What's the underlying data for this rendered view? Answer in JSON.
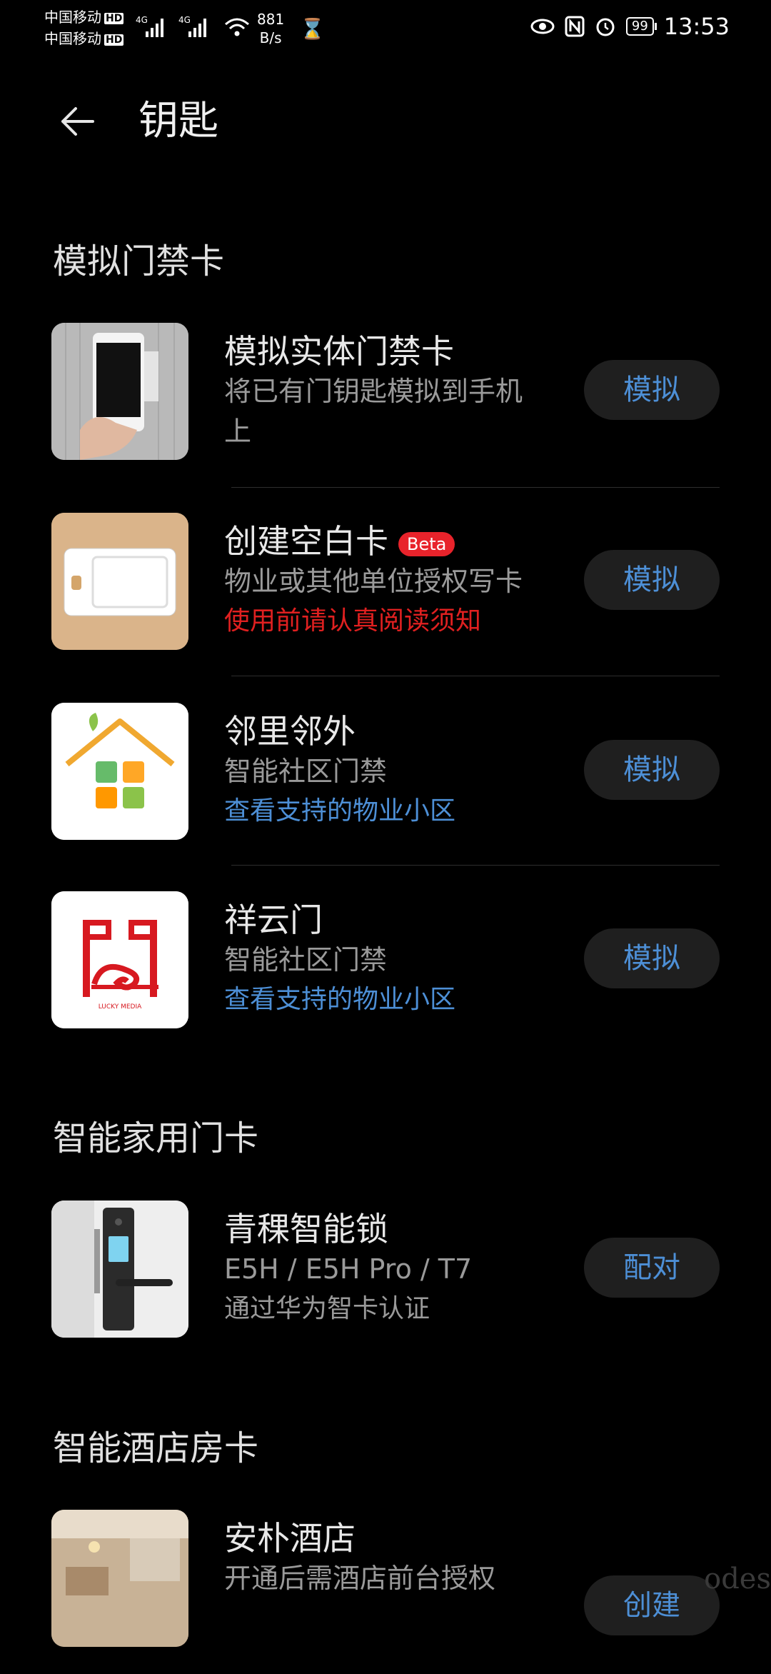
{
  "status_bar": {
    "carrier1": "中国移动",
    "carrier2": "中国移动",
    "hd_label": "HD",
    "net_type": "4G",
    "net_speed_value": "881",
    "net_speed_unit": "B/s",
    "battery": "99",
    "time": "13:53"
  },
  "header": {
    "title": "钥匙",
    "back_icon": "arrow-left-icon"
  },
  "sections": {
    "access": {
      "title": "模拟门禁卡"
    },
    "home": {
      "title": "智能家用门卡"
    },
    "hotel": {
      "title": "智能酒店房卡"
    }
  },
  "items": {
    "simulate_physical": {
      "name": "模拟实体门禁卡",
      "line1": "将已有门钥匙模拟到手机",
      "line2": "上",
      "button": "模拟"
    },
    "blank_card": {
      "name": "创建空白卡",
      "badge": "Beta",
      "line1": "物业或其他单位授权写卡",
      "warning": "使用前请认真阅读须知",
      "button": "模拟"
    },
    "linli": {
      "name": "邻里邻外",
      "line1": "智能社区门禁",
      "link": "查看支持的物业小区",
      "button": "模拟"
    },
    "xiangyun": {
      "name": "祥云门",
      "line1": "智能社区门禁",
      "link": "查看支持的物业小区",
      "button": "模拟",
      "logo_text": "LUCKY MEDIA"
    },
    "qingke": {
      "name": "青稞智能锁",
      "line1": "E5H / E5H Pro / T7",
      "line2": "通过华为智卡认证",
      "button": "配对"
    },
    "anpu": {
      "name": "安朴酒店",
      "line1": "开通后需酒店前台授权",
      "button": "创建"
    }
  },
  "watermark": "odes",
  "colors": {
    "accent": "#4d8fd6",
    "warning": "#e02020",
    "badge": "#e8232b",
    "button_bg": "#1f1f1f"
  }
}
